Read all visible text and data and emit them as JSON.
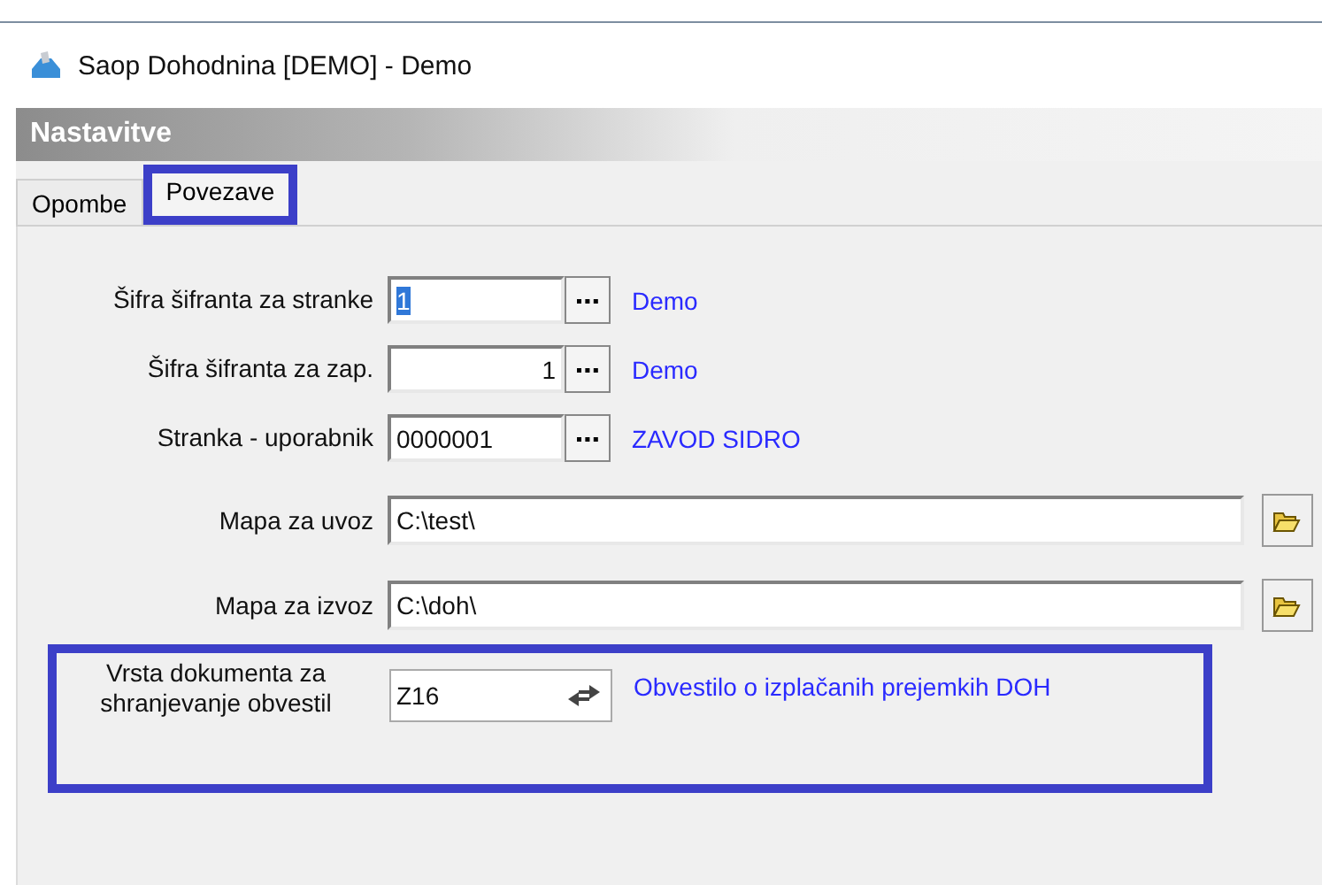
{
  "window": {
    "title": "Saop Dohodnina [DEMO] - Demo"
  },
  "header": {
    "title": "Nastavitve"
  },
  "tabs": [
    {
      "label": "Opombe",
      "selected": false,
      "highlighted": false
    },
    {
      "label": "Povezave",
      "selected": true,
      "highlighted": true
    }
  ],
  "fields": [
    {
      "kind": "lookup",
      "label": "Šifra šifranta za stranke",
      "value": "1",
      "text_selected": true,
      "link": "Demo",
      "highlighted": false
    },
    {
      "kind": "number",
      "label": "Šifra šifranta za zap.",
      "value": "1",
      "text_selected": false,
      "link": "Demo",
      "highlighted": false
    },
    {
      "kind": "lookup",
      "label": "Stranka - uporabnik",
      "value": "0000001",
      "text_selected": false,
      "link": "ZAVOD SIDRO",
      "highlighted": false
    },
    {
      "kind": "folder",
      "label": "Mapa za uvoz",
      "value": "C:\\test\\",
      "highlighted": false
    },
    {
      "kind": "folder",
      "label": "Mapa za izvoz",
      "value": "C:\\doh\\",
      "highlighted": false
    },
    {
      "kind": "swap",
      "label": "Vrsta dokumenta za shranjevanje obvestil",
      "value": "Z16",
      "link": "Obvestilo o izplačanih prejemkih DOH",
      "highlighted": true
    }
  ]
}
